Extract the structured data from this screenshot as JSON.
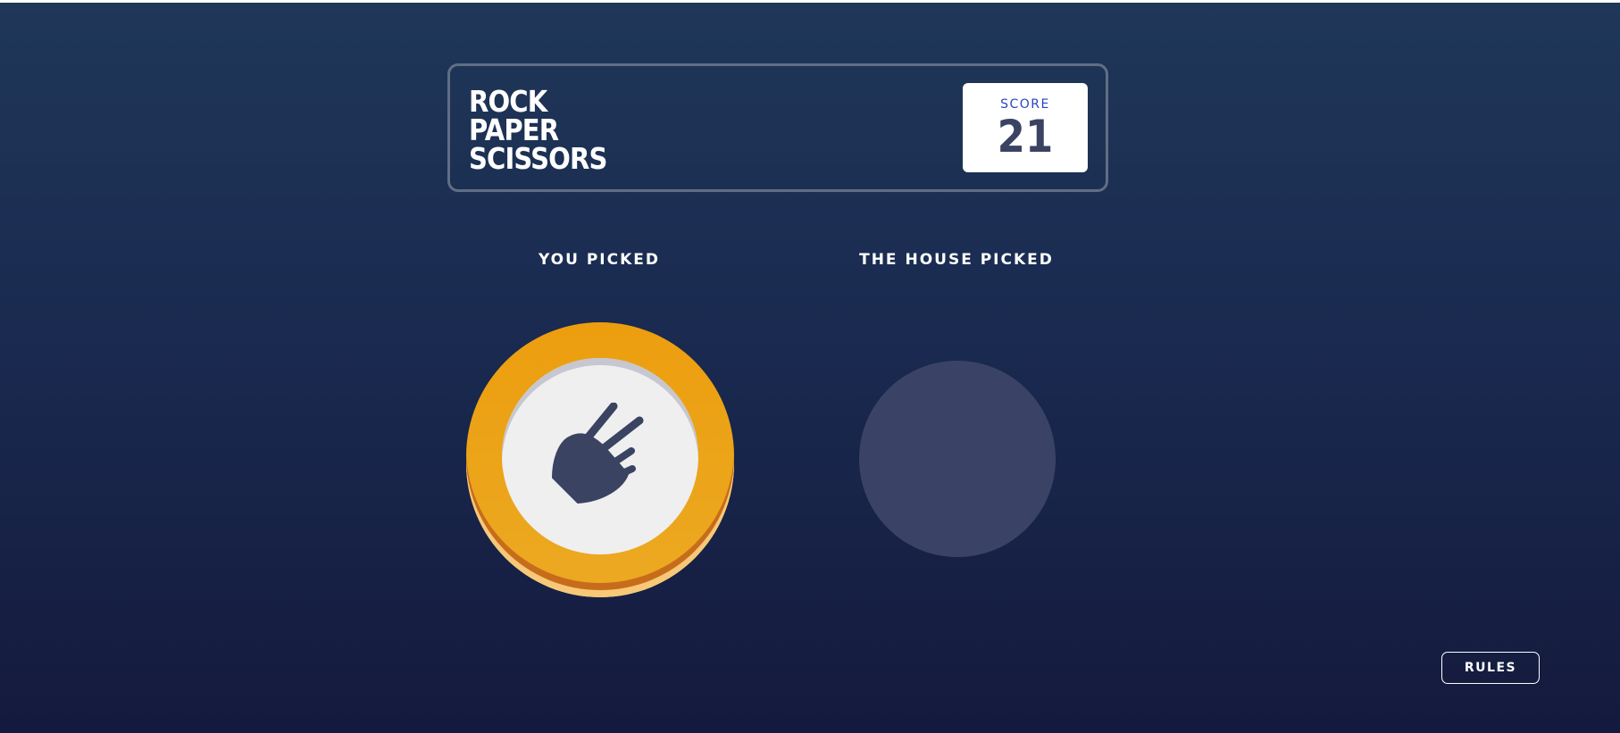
{
  "header": {
    "title_lines": [
      "ROCK",
      "PAPER",
      "SCISSORS"
    ],
    "score_label": "SCORE",
    "score_value": "21"
  },
  "game": {
    "you_picked_label": "YOU PICKED",
    "house_picked_label": "THE HOUSE PICKED",
    "player_choice": "scissors",
    "player_choice_icon": "scissors-hand-icon",
    "house_choice": ""
  },
  "footer": {
    "rules_label": "RULES"
  },
  "colors": {
    "background_top": "#1f3758",
    "background_bottom": "#141a3d",
    "scissors_ring": "#ec9e0e",
    "token_face": "#efefef",
    "icon": "#3b4363",
    "house_placeholder": "#3a4366",
    "score_label": "#2a46c0",
    "score_value": "#3b4363"
  }
}
